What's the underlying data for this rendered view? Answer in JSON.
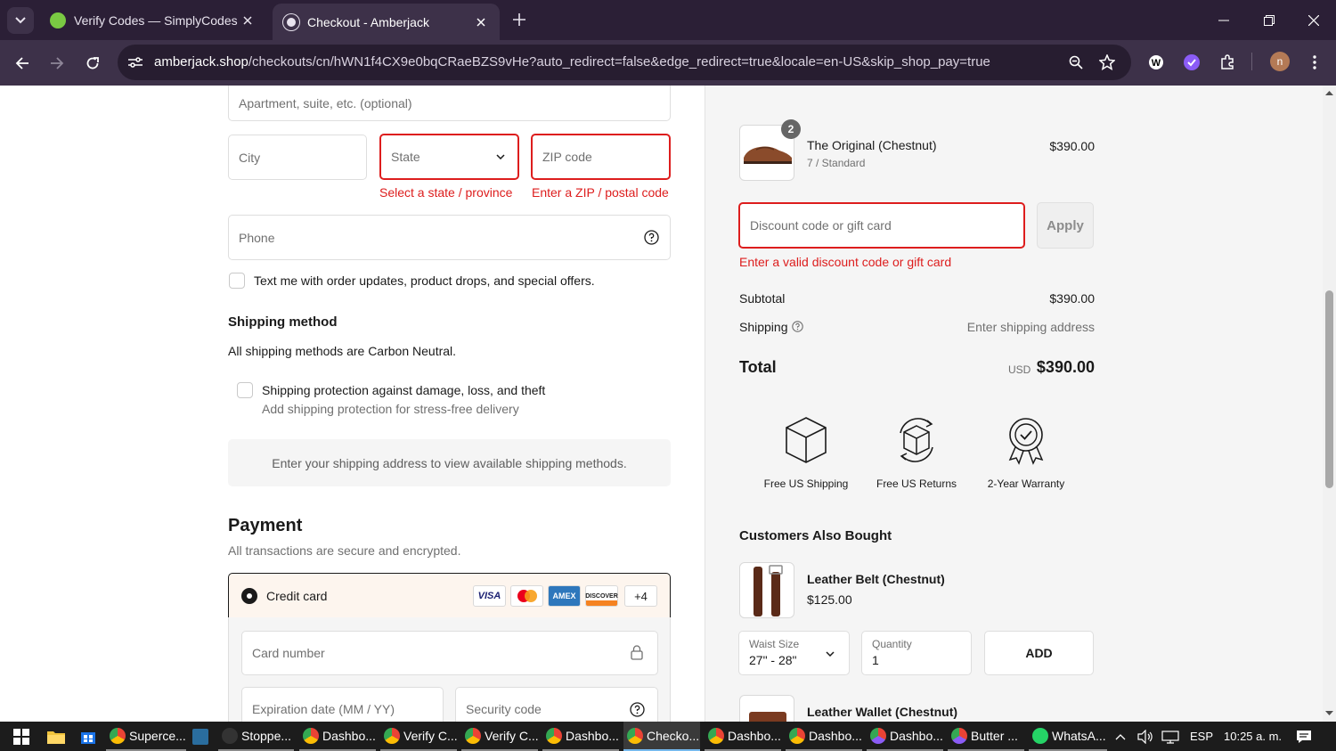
{
  "browser": {
    "tabs": [
      {
        "title": "Verify Codes — SimplyCodes",
        "active": false
      },
      {
        "title": "Checkout - Amberjack",
        "active": true
      }
    ],
    "url_host": "amberjack.shop",
    "url_path": "/checkouts/cn/hWN1f4CX9e0bqCRaeBZS9vHe?auto_redirect=false&edge_redirect=true&locale=en-US&skip_shop_pay=true",
    "profile_initial": "n"
  },
  "form": {
    "apartment_placeholder": "Apartment, suite, etc. (optional)",
    "city_placeholder": "City",
    "state_placeholder": "State",
    "zip_placeholder": "ZIP code",
    "state_error": "Select a state / province",
    "zip_error": "Enter a ZIP / postal code",
    "phone_placeholder": "Phone",
    "sms_optin_label": "Text me with order updates, product drops, and special offers."
  },
  "shipping": {
    "heading": "Shipping method",
    "note": "All shipping methods are Carbon Neutral.",
    "protection_title": "Shipping protection against damage, loss, and theft",
    "protection_subtitle": "Add shipping protection for stress-free delivery",
    "methods_placeholder": "Enter your shipping address to view available shipping methods."
  },
  "payment": {
    "heading": "Payment",
    "subheading": "All transactions are secure and encrypted.",
    "method_label": "Credit card",
    "card_brands": [
      "VISA",
      "Mastercard",
      "AMEX",
      "DISCOVER"
    ],
    "more_brands": "+4",
    "card_number_placeholder": "Card number",
    "expiry_placeholder": "Expiration date (MM / YY)",
    "cvc_placeholder": "Security code"
  },
  "summary": {
    "item": {
      "name": "The Original (Chestnut)",
      "variant": "7 / Standard",
      "price": "$390.00",
      "quantity": "2"
    },
    "discount_placeholder": "Discount code or gift card",
    "apply_label": "Apply",
    "discount_error": "Enter a valid discount code or gift card",
    "subtotal_label": "Subtotal",
    "subtotal_value": "$390.00",
    "shipping_label": "Shipping",
    "shipping_value": "Enter shipping address",
    "total_label": "Total",
    "total_currency": "USD",
    "total_value": "$390.00",
    "badges": [
      "Free US Shipping",
      "Free US Returns",
      "2-Year Warranty"
    ]
  },
  "upsell": {
    "heading": "Customers Also Bought",
    "product1": {
      "name": "Leather Belt (Chestnut)",
      "price": "$125.00",
      "size_label": "Waist Size",
      "size_value": "27\" - 28\"",
      "qty_label": "Quantity",
      "qty_value": "1",
      "add_label": "ADD"
    },
    "product2": {
      "name": "Leather Wallet (Chestnut)"
    }
  },
  "taskbar": {
    "items": [
      "Superce...",
      "Stoppe...",
      "Dashbo...",
      "Verify C...",
      "Verify C...",
      "Dashbo...",
      "Checko...",
      "Dashbo...",
      "Dashbo...",
      "Dashbo...",
      "Butter ...",
      "WhatsA..."
    ],
    "language": "ESP",
    "time": "10:25 a. m."
  },
  "colors": {
    "error": "#dd1d1d",
    "chrome_dark": "#2b1f36",
    "chrome_toolbar": "#3d3149"
  }
}
